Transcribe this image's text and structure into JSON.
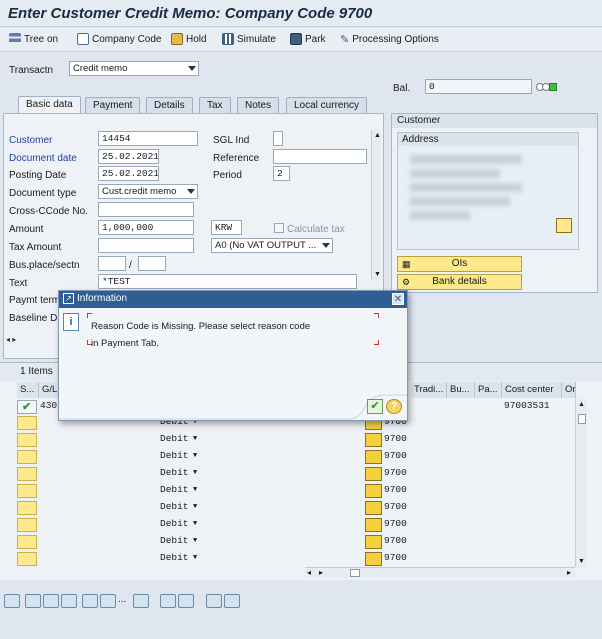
{
  "window": {
    "title": "Enter Customer Credit Memo: Company Code 9700"
  },
  "toolbar": {
    "tree_on": "Tree on",
    "company_code": "Company Code",
    "hold": "Hold",
    "simulate": "Simulate",
    "park": "Park",
    "processing_options": "Processing Options"
  },
  "header": {
    "transactn_label": "Transactn",
    "transactn_value": "Credit memo",
    "bal_label": "Bal.",
    "bal_value": "0"
  },
  "tabs": [
    "Basic data",
    "Payment",
    "Details",
    "Tax",
    "Notes",
    "Local currency"
  ],
  "basic": {
    "customer_label": "Customer",
    "customer_value": "14454",
    "sgl_label": "SGL Ind",
    "docdate_label": "Document date",
    "docdate_value": "25.02.2021",
    "reference_label": "Reference",
    "postdate_label": "Posting Date",
    "postdate_value": "25.02.2021",
    "period_label": "Period",
    "period_value": "2",
    "doctype_label": "Document type",
    "doctype_value": "Cust.credit memo",
    "crossccode_label": "Cross-CCode No.",
    "amount_label": "Amount",
    "amount_value": "1,000,000",
    "currency_value": "KRW",
    "calctax_label": "Calculate tax",
    "taxamount_label": "Tax Amount",
    "taxcode_value": "A0 (No VAT OUTPUT ...",
    "busplace_label": "Bus.place/sectn",
    "slash": "/",
    "text_label": "Text",
    "text_value": "*TEST",
    "paymt_label": "Paymt term",
    "baseline_label": "Baseline Da"
  },
  "customer_panel": {
    "title": "Customer",
    "address_label": "Address",
    "ois_button": "OIs",
    "bank_button": "Bank details"
  },
  "grid": {
    "items_label": "1 Items",
    "headers": [
      "S...",
      "G/L",
      "Tradi...",
      "Bu...",
      "Pa...",
      "Cost center",
      "Or"
    ],
    "first_row": {
      "gl": "4305",
      "code": "9700",
      "cost_center": "97003531"
    },
    "rows": [
      {
        "dc": "Debit",
        "code": "9700"
      },
      {
        "dc": "Debit",
        "code": "9700"
      },
      {
        "dc": "Debit",
        "code": "9700"
      },
      {
        "dc": "Debit",
        "code": "9700"
      },
      {
        "dc": "Debit",
        "code": "9700"
      },
      {
        "dc": "Debit",
        "code": "9700"
      },
      {
        "dc": "Debit",
        "code": "9700"
      },
      {
        "dc": "Debit",
        "code": "9700"
      },
      {
        "dc": "Debit",
        "code": "9700"
      }
    ]
  },
  "dialog": {
    "title": "Information",
    "message_line1": "Reason Code is Missing. Please select reason code",
    "message_line2": "in Payment Tab."
  },
  "colors": {
    "accent": "#2e5e93",
    "required_label": "#1d3fa8",
    "yellow_button": "#fde98c"
  }
}
